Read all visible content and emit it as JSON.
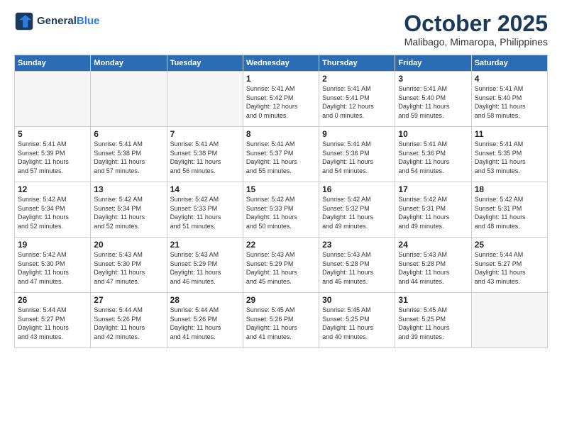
{
  "logo": {
    "line1": "General",
    "line2": "Blue"
  },
  "header": {
    "title": "October 2025",
    "subtitle": "Malibago, Mimaropa, Philippines"
  },
  "weekdays": [
    "Sunday",
    "Monday",
    "Tuesday",
    "Wednesday",
    "Thursday",
    "Friday",
    "Saturday"
  ],
  "weeks": [
    [
      {
        "day": "",
        "info": ""
      },
      {
        "day": "",
        "info": ""
      },
      {
        "day": "",
        "info": ""
      },
      {
        "day": "1",
        "info": "Sunrise: 5:41 AM\nSunset: 5:42 PM\nDaylight: 12 hours\nand 0 minutes."
      },
      {
        "day": "2",
        "info": "Sunrise: 5:41 AM\nSunset: 5:41 PM\nDaylight: 12 hours\nand 0 minutes."
      },
      {
        "day": "3",
        "info": "Sunrise: 5:41 AM\nSunset: 5:40 PM\nDaylight: 11 hours\nand 59 minutes."
      },
      {
        "day": "4",
        "info": "Sunrise: 5:41 AM\nSunset: 5:40 PM\nDaylight: 11 hours\nand 58 minutes."
      }
    ],
    [
      {
        "day": "5",
        "info": "Sunrise: 5:41 AM\nSunset: 5:39 PM\nDaylight: 11 hours\nand 57 minutes."
      },
      {
        "day": "6",
        "info": "Sunrise: 5:41 AM\nSunset: 5:38 PM\nDaylight: 11 hours\nand 57 minutes."
      },
      {
        "day": "7",
        "info": "Sunrise: 5:41 AM\nSunset: 5:38 PM\nDaylight: 11 hours\nand 56 minutes."
      },
      {
        "day": "8",
        "info": "Sunrise: 5:41 AM\nSunset: 5:37 PM\nDaylight: 11 hours\nand 55 minutes."
      },
      {
        "day": "9",
        "info": "Sunrise: 5:41 AM\nSunset: 5:36 PM\nDaylight: 11 hours\nand 54 minutes."
      },
      {
        "day": "10",
        "info": "Sunrise: 5:41 AM\nSunset: 5:36 PM\nDaylight: 11 hours\nand 54 minutes."
      },
      {
        "day": "11",
        "info": "Sunrise: 5:41 AM\nSunset: 5:35 PM\nDaylight: 11 hours\nand 53 minutes."
      }
    ],
    [
      {
        "day": "12",
        "info": "Sunrise: 5:42 AM\nSunset: 5:34 PM\nDaylight: 11 hours\nand 52 minutes."
      },
      {
        "day": "13",
        "info": "Sunrise: 5:42 AM\nSunset: 5:34 PM\nDaylight: 11 hours\nand 52 minutes."
      },
      {
        "day": "14",
        "info": "Sunrise: 5:42 AM\nSunset: 5:33 PM\nDaylight: 11 hours\nand 51 minutes."
      },
      {
        "day": "15",
        "info": "Sunrise: 5:42 AM\nSunset: 5:33 PM\nDaylight: 11 hours\nand 50 minutes."
      },
      {
        "day": "16",
        "info": "Sunrise: 5:42 AM\nSunset: 5:32 PM\nDaylight: 11 hours\nand 49 minutes."
      },
      {
        "day": "17",
        "info": "Sunrise: 5:42 AM\nSunset: 5:31 PM\nDaylight: 11 hours\nand 49 minutes."
      },
      {
        "day": "18",
        "info": "Sunrise: 5:42 AM\nSunset: 5:31 PM\nDaylight: 11 hours\nand 48 minutes."
      }
    ],
    [
      {
        "day": "19",
        "info": "Sunrise: 5:42 AM\nSunset: 5:30 PM\nDaylight: 11 hours\nand 47 minutes."
      },
      {
        "day": "20",
        "info": "Sunrise: 5:43 AM\nSunset: 5:30 PM\nDaylight: 11 hours\nand 47 minutes."
      },
      {
        "day": "21",
        "info": "Sunrise: 5:43 AM\nSunset: 5:29 PM\nDaylight: 11 hours\nand 46 minutes."
      },
      {
        "day": "22",
        "info": "Sunrise: 5:43 AM\nSunset: 5:29 PM\nDaylight: 11 hours\nand 45 minutes."
      },
      {
        "day": "23",
        "info": "Sunrise: 5:43 AM\nSunset: 5:28 PM\nDaylight: 11 hours\nand 45 minutes."
      },
      {
        "day": "24",
        "info": "Sunrise: 5:43 AM\nSunset: 5:28 PM\nDaylight: 11 hours\nand 44 minutes."
      },
      {
        "day": "25",
        "info": "Sunrise: 5:44 AM\nSunset: 5:27 PM\nDaylight: 11 hours\nand 43 minutes."
      }
    ],
    [
      {
        "day": "26",
        "info": "Sunrise: 5:44 AM\nSunset: 5:27 PM\nDaylight: 11 hours\nand 43 minutes."
      },
      {
        "day": "27",
        "info": "Sunrise: 5:44 AM\nSunset: 5:26 PM\nDaylight: 11 hours\nand 42 minutes."
      },
      {
        "day": "28",
        "info": "Sunrise: 5:44 AM\nSunset: 5:26 PM\nDaylight: 11 hours\nand 41 minutes."
      },
      {
        "day": "29",
        "info": "Sunrise: 5:45 AM\nSunset: 5:26 PM\nDaylight: 11 hours\nand 41 minutes."
      },
      {
        "day": "30",
        "info": "Sunrise: 5:45 AM\nSunset: 5:25 PM\nDaylight: 11 hours\nand 40 minutes."
      },
      {
        "day": "31",
        "info": "Sunrise: 5:45 AM\nSunset: 5:25 PM\nDaylight: 11 hours\nand 39 minutes."
      },
      {
        "day": "",
        "info": ""
      }
    ]
  ]
}
